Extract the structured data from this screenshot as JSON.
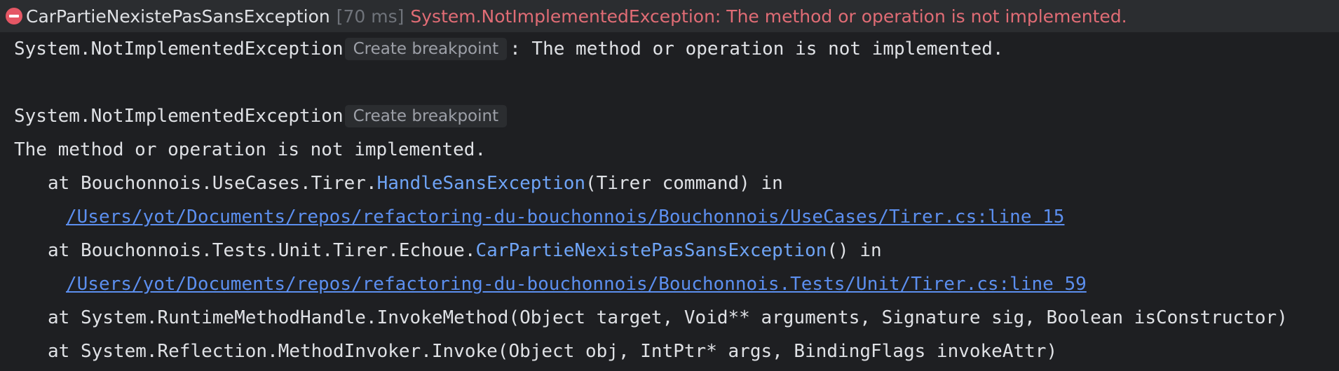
{
  "header": {
    "test_name": "CarPartieNexistePasSansException",
    "duration": "[70 ms]",
    "message": "System.NotImplementedException: The method or operation is not implemented."
  },
  "output": {
    "line1_exception": "System.NotImplementedException",
    "breakpoint_label": "Create breakpoint",
    "line1_message": ": The method or operation is not implemented.",
    "line2_exception": "System.NotImplementedException",
    "line3_message": "The method or operation is not implemented.",
    "stack": [
      {
        "prefix": "at Bouchonnois.UseCases.Tirer.",
        "method": "HandleSansException",
        "suffix": "(Tirer command) in",
        "path": "/Users/yot/Documents/repos/refactoring-du-bouchonnois/Bouchonnois/UseCases/Tirer.cs:line 15"
      },
      {
        "prefix": "at Bouchonnois.Tests.Unit.Tirer.Echoue.",
        "method": "CarPartieNexistePasSansException",
        "suffix": "() in",
        "path": "/Users/yot/Documents/repos/refactoring-du-bouchonnois/Bouchonnois.Tests/Unit/Tirer.cs:line 59"
      },
      {
        "text": "at System.RuntimeMethodHandle.InvokeMethod(Object target, Void** arguments, Signature sig, Boolean isConstructor)"
      },
      {
        "text": "at System.Reflection.MethodInvoker.Invoke(Object obj, IntPtr* args, BindingFlags invokeAttr)"
      }
    ]
  },
  "colors": {
    "background": "#1e1f22",
    "header_background": "#2b2d30",
    "error_red": "#e06c75",
    "method_blue": "#6fa4f5",
    "link_blue": "#5c8fef",
    "text": "#dfe1e5",
    "muted": "#6f737a"
  },
  "icons": {
    "status": "error-circle-icon"
  }
}
